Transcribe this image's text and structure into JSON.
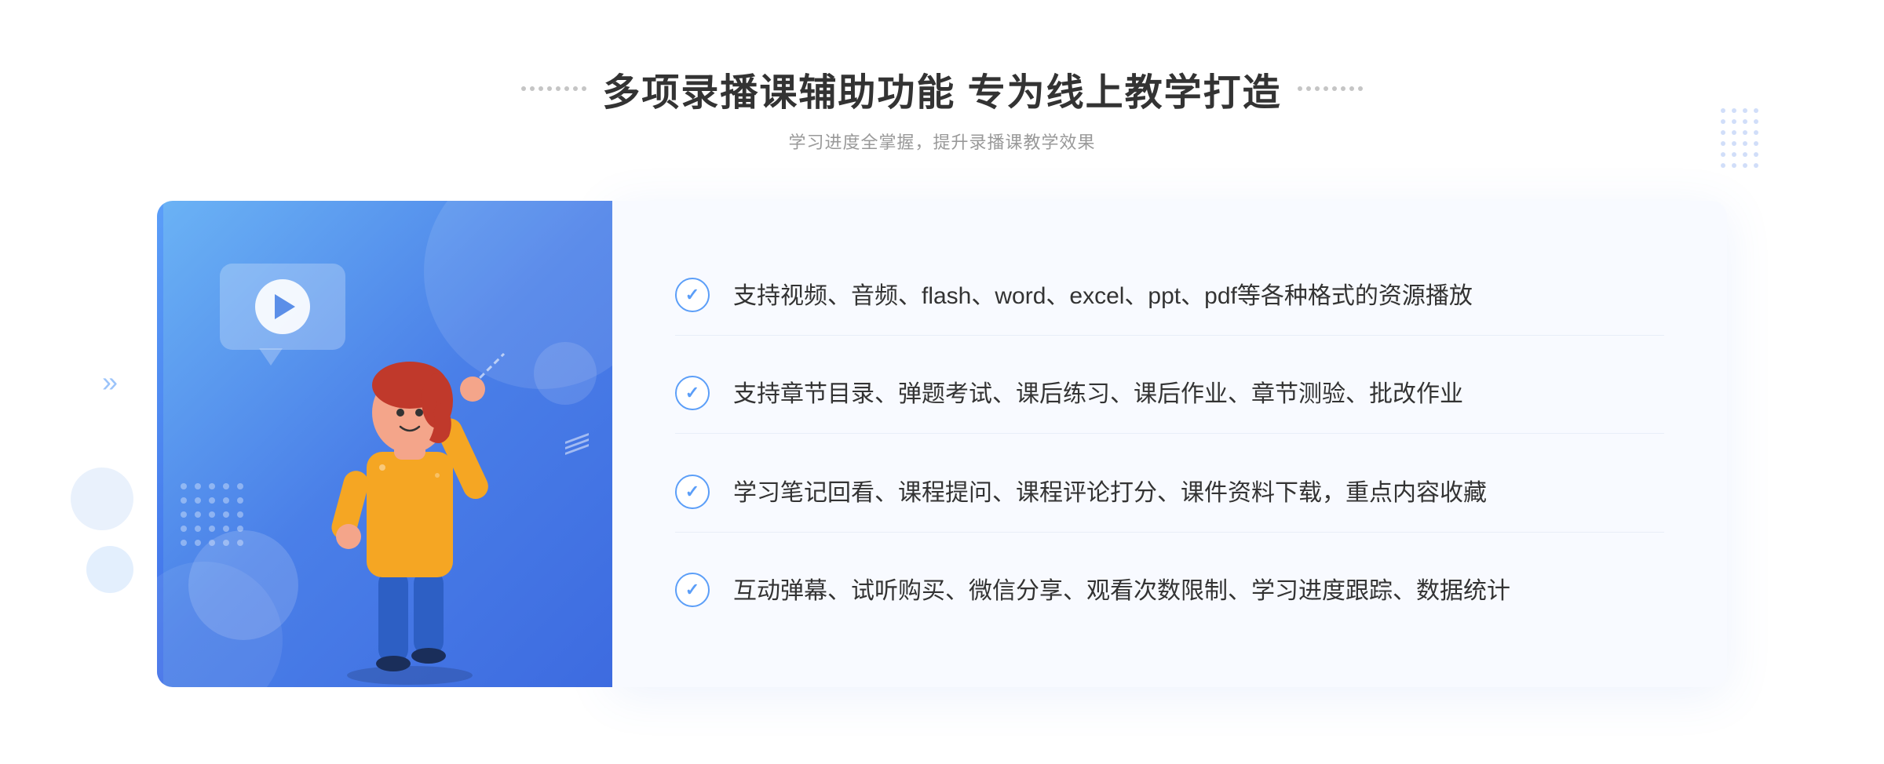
{
  "page": {
    "title": "多项录播课辅助功能 专为线上教学打造",
    "subtitle": "学习进度全掌握，提升录播课教学效果",
    "features": [
      {
        "id": 1,
        "text": "支持视频、音频、flash、word、excel、ppt、pdf等各种格式的资源播放"
      },
      {
        "id": 2,
        "text": "支持章节目录、弹题考试、课后练习、课后作业、章节测验、批改作业"
      },
      {
        "id": 3,
        "text": "学习笔记回看、课程提问、课程评论打分、课件资料下载，重点内容收藏"
      },
      {
        "id": 4,
        "text": "互动弹幕、试听购买、微信分享、观看次数限制、学习进度跟踪、数据统计"
      }
    ],
    "decoration": {
      "title_deco_left": "❋ ❋",
      "title_deco_right": "❋ ❋",
      "chevron_left": "»"
    }
  }
}
